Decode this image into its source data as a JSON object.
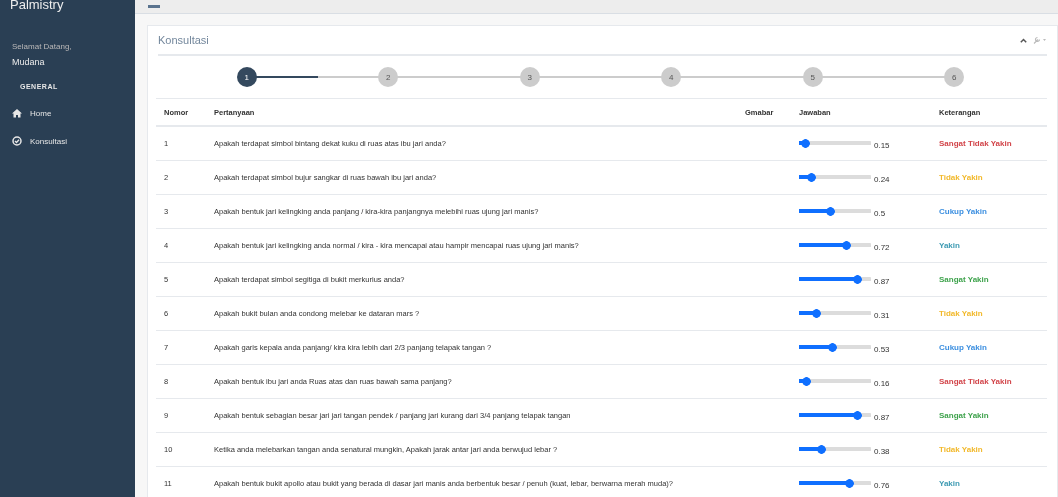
{
  "sidebar": {
    "brand": "Palmistry",
    "welcome": "Selamat Datang,",
    "user": "Mudana",
    "section": "GENERAL",
    "items": [
      {
        "label": "Home"
      },
      {
        "label": "Konsultasi"
      }
    ]
  },
  "panel": {
    "title": "Konsultasi"
  },
  "steps": [
    {
      "label": "1",
      "selected": true
    },
    {
      "label": "2",
      "selected": false
    },
    {
      "label": "3",
      "selected": false
    },
    {
      "label": "4",
      "selected": false
    },
    {
      "label": "5",
      "selected": false
    },
    {
      "label": "6",
      "selected": false
    }
  ],
  "table": {
    "columns": [
      "Nomor",
      "Pertanyaan",
      "Gmabar",
      "Jawaban",
      "Keterangan"
    ],
    "rows": [
      {
        "no": "1",
        "question": "Apakah terdapat simbol bintang dekat kuku di ruas atas ibu jari anda?",
        "level": 0.15,
        "reading": "0.15",
        "note": "Sangat Tidak Yakin",
        "color": "#d2454a"
      },
      {
        "no": "2",
        "question": "Apakah terdapat simbol bujur sangkar di ruas bawah ibu jari anda?",
        "level": 0.24,
        "reading": "0.24",
        "note": "Tidak Yakin",
        "color": "#f2b92c"
      },
      {
        "no": "3",
        "question": "Apakah bentuk jari kelingking anda panjang / kira-kira panjangnya melebihi ruas ujung jari manis?",
        "level": 0.5,
        "reading": "0.5",
        "note": "Cukup Yakin",
        "color": "#3c8fe0"
      },
      {
        "no": "4",
        "question": "Apakah bentuk jari kelingking anda normal / kira - kira mencapai atau hampir mencapai ruas ujung jari manis?",
        "level": 0.72,
        "reading": "0.72",
        "note": "Yakin",
        "color": "#3e9bb3"
      },
      {
        "no": "5",
        "question": "Apakah terdapat simbol segitiga di bukit merkurius anda?",
        "level": 0.87,
        "reading": "0.87",
        "note": "Sangat Yakin",
        "color": "#3fa34d"
      },
      {
        "no": "6",
        "question": "Apakah bukit bulan anda condong melebar ke dataran mars ?",
        "level": 0.31,
        "reading": "0.31",
        "note": "Tidak Yakin",
        "color": "#f2b92c"
      },
      {
        "no": "7",
        "question": "Apakah garis kepala anda panjang/ kira kira lebih dari 2/3 panjang telapak tangan ?",
        "level": 0.53,
        "reading": "0.53",
        "note": "Cukup Yakin",
        "color": "#3c8fe0"
      },
      {
        "no": "8",
        "question": "Apakah bentuk ibu jari anda Ruas atas dan ruas bawah sama panjang?",
        "level": 0.16,
        "reading": "0.16",
        "note": "Sangat Tidak Yakin",
        "color": "#d2454a"
      },
      {
        "no": "9",
        "question": "Apakah bentuk sebagian besar jari jari tangan pendek / panjang jari kurang dari 3/4 panjang telapak tangan",
        "level": 0.87,
        "reading": "0.87",
        "note": "Sangat Yakin",
        "color": "#3fa34d"
      },
      {
        "no": "10",
        "question": "Ketika anda melebarkan tangan anda senatural mungkin, Apakah jarak antar jari anda berwujud lebar ?",
        "level": 0.38,
        "reading": "0.38",
        "note": "Tidak Yakin",
        "color": "#f2b92c"
      },
      {
        "no": "11",
        "question": "Apakah bentuk bukit apollo atau bukit yang berada di dasar jari manis anda berbentuk besar / penuh (kuat, lebar, berwarna merah muda)?",
        "level": 0.76,
        "reading": "0.76",
        "note": "Yakin",
        "color": "#3e9bb3"
      }
    ]
  }
}
